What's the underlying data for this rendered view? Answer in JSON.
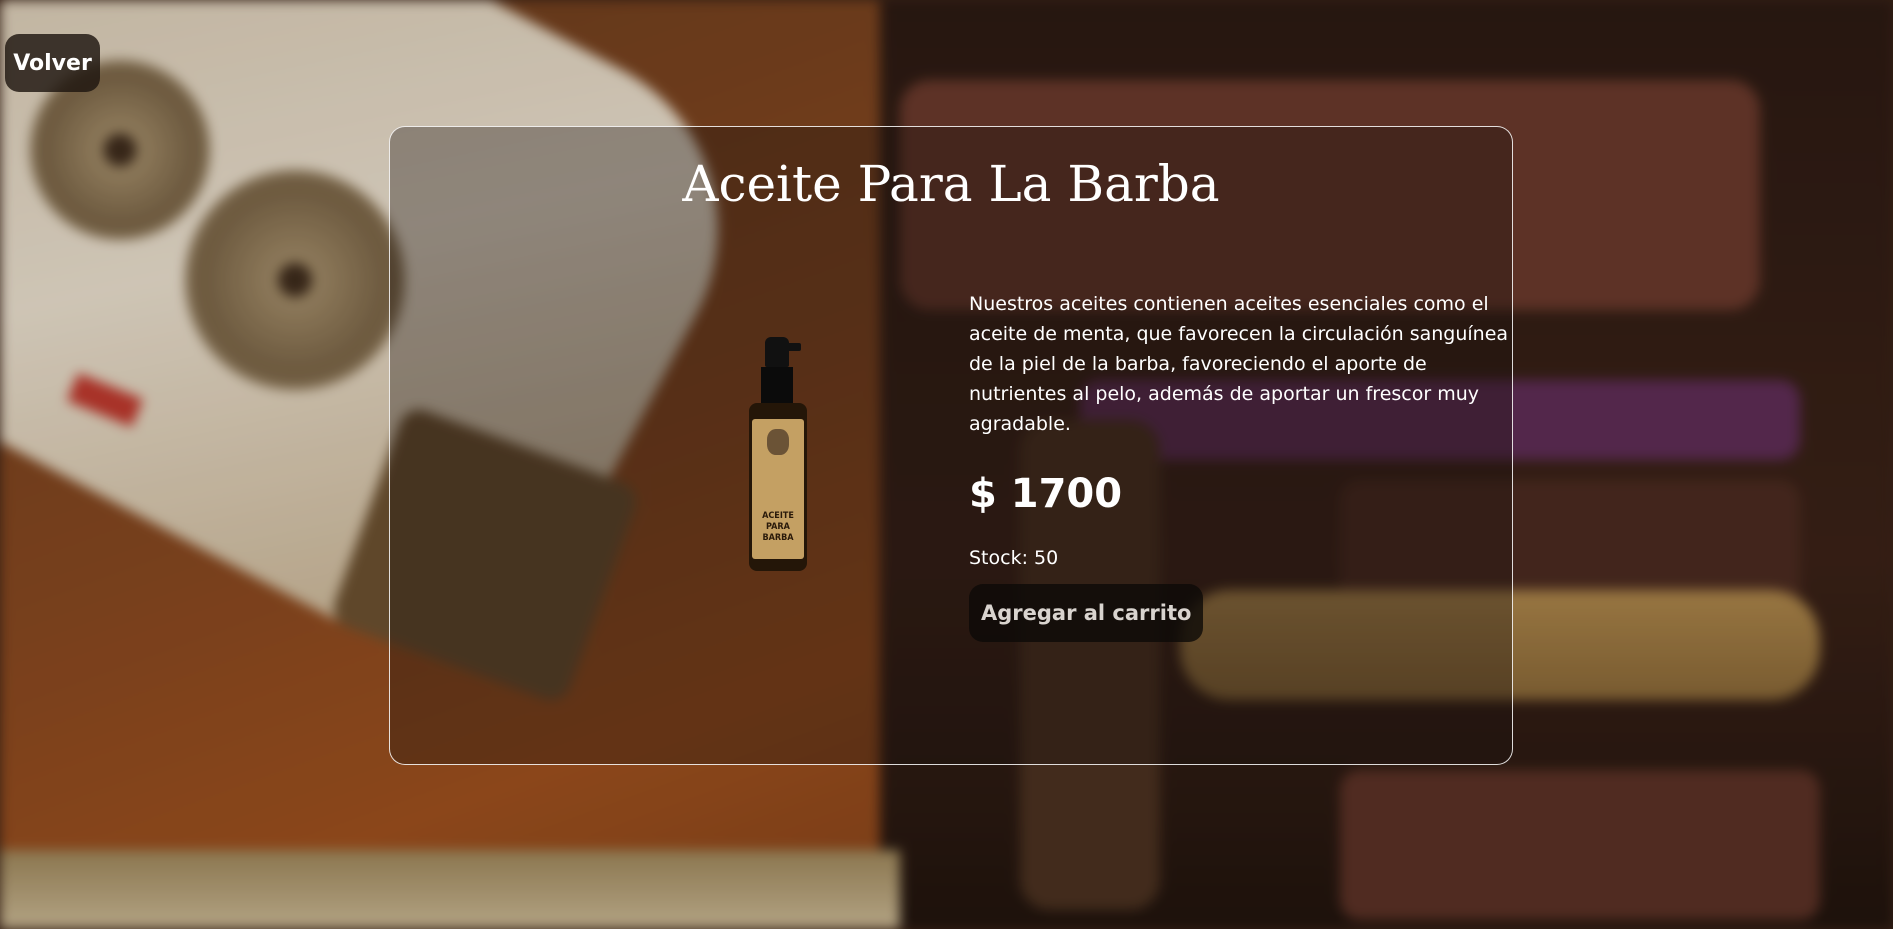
{
  "nav": {
    "back_label": "Volver"
  },
  "product": {
    "name": "Aceite Para La Barba",
    "description": "Nuestros aceites contienen aceites esenciales como el aceite de menta, que favorecen la circulación sanguínea de la piel de la barba, favoreciendo el aporte de nutrientes al pelo, además de aportar un frescor muy agradable.",
    "price": "$ 1700",
    "stock": "Stock: 50",
    "add_to_cart_label": "Agregar al carrito",
    "image_label_text": "ACEITE PARA BARBA"
  },
  "colors": {
    "text": "#ffffff",
    "button_bg": "#1e1610",
    "card_border": "#ffffff"
  }
}
